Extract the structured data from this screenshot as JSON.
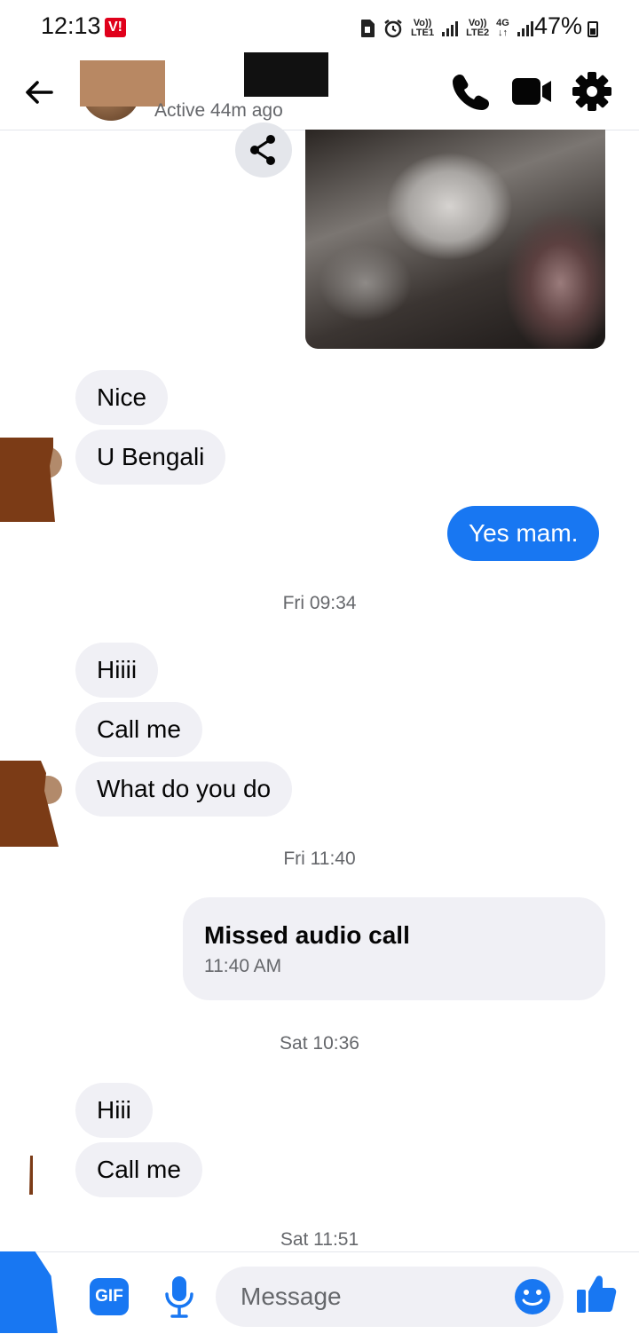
{
  "status_bar": {
    "time": "12:13",
    "carrier_badge": "V!",
    "lte1_top": "Vo))",
    "lte1_bottom": "LTE1",
    "lte2_top": "Vo))",
    "lte2_bottom": "LTE2",
    "network": "4G",
    "battery_percent": "47%"
  },
  "header": {
    "active_status": "Active 44m ago"
  },
  "messages": [
    {
      "side": "in",
      "text": "Nice"
    },
    {
      "side": "in",
      "text": "U Bengali"
    },
    {
      "side": "out",
      "text": "Yes mam."
    },
    {
      "type": "timestamp",
      "text": "Fri 09:34"
    },
    {
      "side": "in",
      "text": "Hiiii"
    },
    {
      "side": "in",
      "text": "Call me"
    },
    {
      "side": "in",
      "text": "What do you do"
    },
    {
      "type": "timestamp",
      "text": "Fri 11:40"
    },
    {
      "type": "call",
      "title": "Missed audio call",
      "time": "11:40 AM"
    },
    {
      "type": "timestamp",
      "text": "Sat 10:36"
    },
    {
      "side": "in",
      "text": "Hiii"
    },
    {
      "side": "in",
      "text": "Call me"
    },
    {
      "type": "timestamp",
      "text": "Sat 11:51"
    }
  ],
  "composer": {
    "gif_label": "GIF",
    "placeholder": "Message"
  },
  "colors": {
    "accent": "#1877f2",
    "bubble_in": "#f0f0f5",
    "secondary_text": "#65676b"
  },
  "icons": [
    "back-arrow-icon",
    "phone-icon",
    "video-camera-icon",
    "gear-icon",
    "share-icon",
    "microphone-icon",
    "emoji-icon",
    "thumbs-up-icon"
  ]
}
